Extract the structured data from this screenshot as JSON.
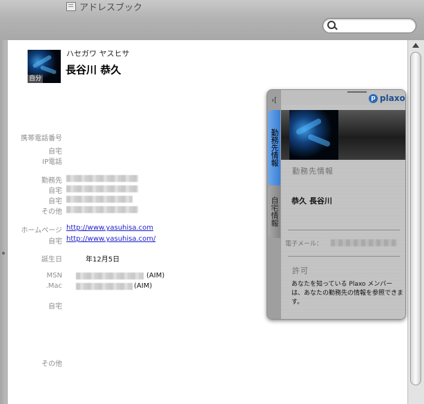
{
  "window": {
    "title": "アドレスブック"
  },
  "search": {
    "value": "",
    "placeholder": ""
  },
  "contact": {
    "kana": "ハセガワ ヤスヒサ",
    "name": "長谷川 恭久",
    "avatar_badge": "自分"
  },
  "fields": {
    "mobile_label": "携帯電話番号",
    "home_label": "自宅",
    "ip_phone_label": "IP電話",
    "work_label": "勤務先",
    "home2_label": "自宅",
    "home3_label": "自宅",
    "other_label": "その他",
    "homepage_label": "ホームページ",
    "homepage_url": "http://www.yasuhisa.com",
    "homepage_home_label": "自宅",
    "homepage_home_url": "http://www.yasuhisa.com/",
    "birthday_label": "誕生日",
    "birthday_value": "年12月5日",
    "msn_label": "MSN",
    "msn_suffix": "(AIM)",
    "mac_label": ".Mac",
    "mac_suffix": "(AIM)",
    "address_home_label": "自宅",
    "note_other_label": "その他"
  },
  "widget": {
    "side_corner": "›[",
    "tab_work": "勤務先情報",
    "tab_home": "自宅情報",
    "brand": "plaxo",
    "brand_initial": "p",
    "section_title": "勤務先情報",
    "name": "恭久 長谷川",
    "email_label": "電子メール：",
    "permission_title": "許可",
    "permission_text": "あなたを知っている Plaxo メンバーは、あなたの勤務先の情報を参照できます。"
  }
}
